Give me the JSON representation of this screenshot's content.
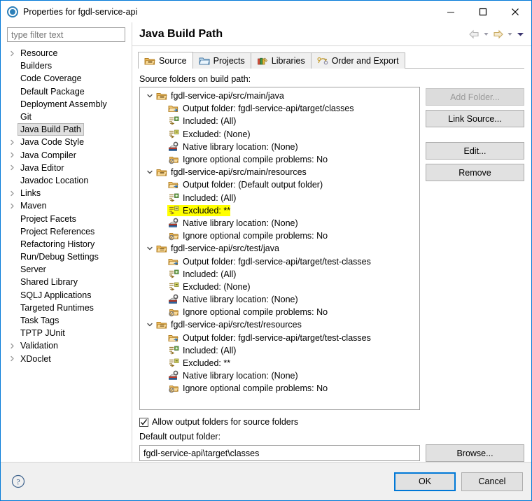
{
  "window": {
    "title": "Properties for fgdl-service-api",
    "icon": "properties-icon",
    "minimize_label": "—",
    "maximize_label": "□",
    "close_label": "✕"
  },
  "sidebar": {
    "filter": {
      "placeholder": "type filter text",
      "value": ""
    },
    "items": [
      {
        "label": "Resource",
        "expandable": true,
        "selected": false
      },
      {
        "label": "Builders",
        "expandable": false,
        "selected": false
      },
      {
        "label": "Code Coverage",
        "expandable": false,
        "selected": false
      },
      {
        "label": "Default Package",
        "expandable": false,
        "selected": false
      },
      {
        "label": "Deployment Assembly",
        "expandable": false,
        "selected": false
      },
      {
        "label": "Git",
        "expandable": false,
        "selected": false
      },
      {
        "label": "Java Build Path",
        "expandable": false,
        "selected": true
      },
      {
        "label": "Java Code Style",
        "expandable": true,
        "selected": false
      },
      {
        "label": "Java Compiler",
        "expandable": true,
        "selected": false
      },
      {
        "label": "Java Editor",
        "expandable": true,
        "selected": false
      },
      {
        "label": "Javadoc Location",
        "expandable": false,
        "selected": false
      },
      {
        "label": "Links",
        "expandable": true,
        "selected": false
      },
      {
        "label": "Maven",
        "expandable": true,
        "selected": false
      },
      {
        "label": "Project Facets",
        "expandable": false,
        "selected": false
      },
      {
        "label": "Project References",
        "expandable": false,
        "selected": false
      },
      {
        "label": "Refactoring History",
        "expandable": false,
        "selected": false
      },
      {
        "label": "Run/Debug Settings",
        "expandable": false,
        "selected": false
      },
      {
        "label": "Server",
        "expandable": false,
        "selected": false
      },
      {
        "label": "Shared Library",
        "expandable": false,
        "selected": false
      },
      {
        "label": "SQLJ Applications",
        "expandable": false,
        "selected": false
      },
      {
        "label": "Targeted Runtimes",
        "expandable": false,
        "selected": false
      },
      {
        "label": "Task Tags",
        "expandable": false,
        "selected": false
      },
      {
        "label": "TPTP JUnit",
        "expandable": false,
        "selected": false
      },
      {
        "label": "Validation",
        "expandable": true,
        "selected": false
      },
      {
        "label": "XDoclet",
        "expandable": true,
        "selected": false
      }
    ]
  },
  "page": {
    "title": "Java Build Path",
    "nav": {
      "back_icon": "back-arrow-icon",
      "back_menu_icon": "chevron-down-icon",
      "forward_icon": "forward-arrow-icon",
      "forward_menu_icon": "chevron-down-icon",
      "menu_icon": "chevron-down-filled-icon"
    }
  },
  "tabs": [
    {
      "label": "Source",
      "icon": "source-folder-icon",
      "active": true
    },
    {
      "label": "Projects",
      "icon": "projects-folder-icon",
      "active": false
    },
    {
      "label": "Libraries",
      "icon": "libraries-books-icon",
      "active": false
    },
    {
      "label": "Order and Export",
      "icon": "order-export-icon",
      "active": false
    }
  ],
  "source_tab": {
    "tree_label": "Source folders on build path:",
    "tree": [
      {
        "label": "fgdl-service-api/src/main/java",
        "icon": "source-folder-icon",
        "expanded": true,
        "children": [
          {
            "label": "Output folder: fgdl-service-api/target/classes",
            "icon": "output-folder-icon",
            "highlighted": false
          },
          {
            "label": "Included: (All)",
            "icon": "included-filter-icon",
            "highlighted": false
          },
          {
            "label": "Excluded: (None)",
            "icon": "excluded-filter-icon",
            "highlighted": false
          },
          {
            "label": "Native library location: (None)",
            "icon": "native-library-icon",
            "highlighted": false
          },
          {
            "label": "Ignore optional compile problems: No",
            "icon": "ignore-problems-icon",
            "highlighted": false
          }
        ]
      },
      {
        "label": "fgdl-service-api/src/main/resources",
        "icon": "source-folder-icon",
        "expanded": true,
        "children": [
          {
            "label": "Output folder: (Default output folder)",
            "icon": "output-folder-icon",
            "highlighted": false
          },
          {
            "label": "Included: (All)",
            "icon": "included-filter-icon",
            "highlighted": false
          },
          {
            "label": "Excluded: **",
            "icon": "excluded-filter-icon",
            "highlighted": true
          },
          {
            "label": "Native library location: (None)",
            "icon": "native-library-icon",
            "highlighted": false
          },
          {
            "label": "Ignore optional compile problems: No",
            "icon": "ignore-problems-icon",
            "highlighted": false
          }
        ]
      },
      {
        "label": "fgdl-service-api/src/test/java",
        "icon": "source-folder-icon",
        "expanded": true,
        "children": [
          {
            "label": "Output folder: fgdl-service-api/target/test-classes",
            "icon": "output-folder-icon",
            "highlighted": false
          },
          {
            "label": "Included: (All)",
            "icon": "included-filter-icon",
            "highlighted": false
          },
          {
            "label": "Excluded: (None)",
            "icon": "excluded-filter-icon",
            "highlighted": false
          },
          {
            "label": "Native library location: (None)",
            "icon": "native-library-icon",
            "highlighted": false
          },
          {
            "label": "Ignore optional compile problems: No",
            "icon": "ignore-problems-icon",
            "highlighted": false
          }
        ]
      },
      {
        "label": "fgdl-service-api/src/test/resources",
        "icon": "source-folder-icon",
        "expanded": true,
        "children": [
          {
            "label": "Output folder: fgdl-service-api/target/test-classes",
            "icon": "output-folder-icon",
            "highlighted": false
          },
          {
            "label": "Included: (All)",
            "icon": "included-filter-icon",
            "highlighted": false
          },
          {
            "label": "Excluded: **",
            "icon": "excluded-filter-icon",
            "highlighted": false
          },
          {
            "label": "Native library location: (None)",
            "icon": "native-library-icon",
            "highlighted": false
          },
          {
            "label": "Ignore optional compile problems: No",
            "icon": "ignore-problems-icon",
            "highlighted": false
          }
        ]
      }
    ],
    "buttons": [
      {
        "label": "Add Folder...",
        "disabled": true
      },
      {
        "label": "Link Source...",
        "disabled": false
      },
      {
        "label": "Edit...",
        "disabled": false
      },
      {
        "label": "Remove",
        "disabled": false
      }
    ],
    "allow_output_folders": {
      "label": "Allow output folders for source folders",
      "checked": true
    },
    "default_output": {
      "label": "Default output folder:",
      "value": "fgdl-service-api\\target\\classes",
      "browse_label": "Browse..."
    }
  },
  "footer": {
    "help_icon": "help-question-icon",
    "ok_label": "OK",
    "cancel_label": "Cancel"
  },
  "colors": {
    "accent": "#0078d7",
    "highlight": "#ffff00",
    "selection": "#e0e0e0",
    "folder": "#e8a33d",
    "chrome": "#f0f0f0"
  }
}
